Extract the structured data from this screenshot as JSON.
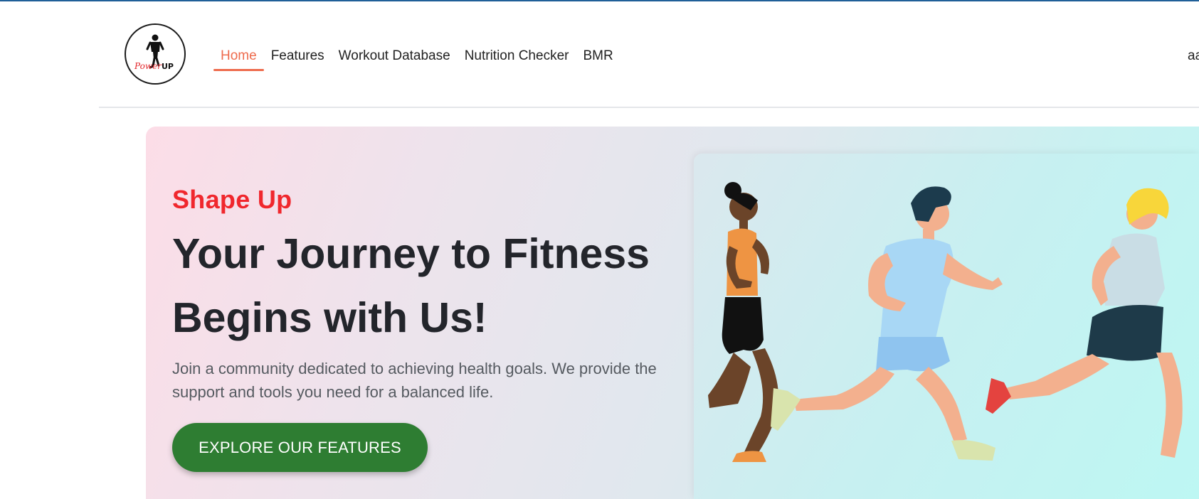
{
  "nav": {
    "logo_text_left": "Power",
    "logo_text_right": "UP",
    "links": [
      {
        "label": "Home",
        "active": true
      },
      {
        "label": "Features",
        "active": false
      },
      {
        "label": "Workout Database",
        "active": false
      },
      {
        "label": "Nutrition Checker",
        "active": false
      },
      {
        "label": "BMR",
        "active": false
      }
    ],
    "user_name": "aa"
  },
  "hero": {
    "eyebrow": "Shape Up",
    "headline": "Your Journey to Fitness Begins with Us!",
    "subtext": "Join a community dedicated to achieving health goals. We provide the support and tools you need for a balanced life.",
    "cta_label": "EXPLORE OUR FEATURES"
  },
  "colors": {
    "accent": "#ee6b4d",
    "eyebrow": "#f0272d",
    "cta": "#2e7d32"
  }
}
